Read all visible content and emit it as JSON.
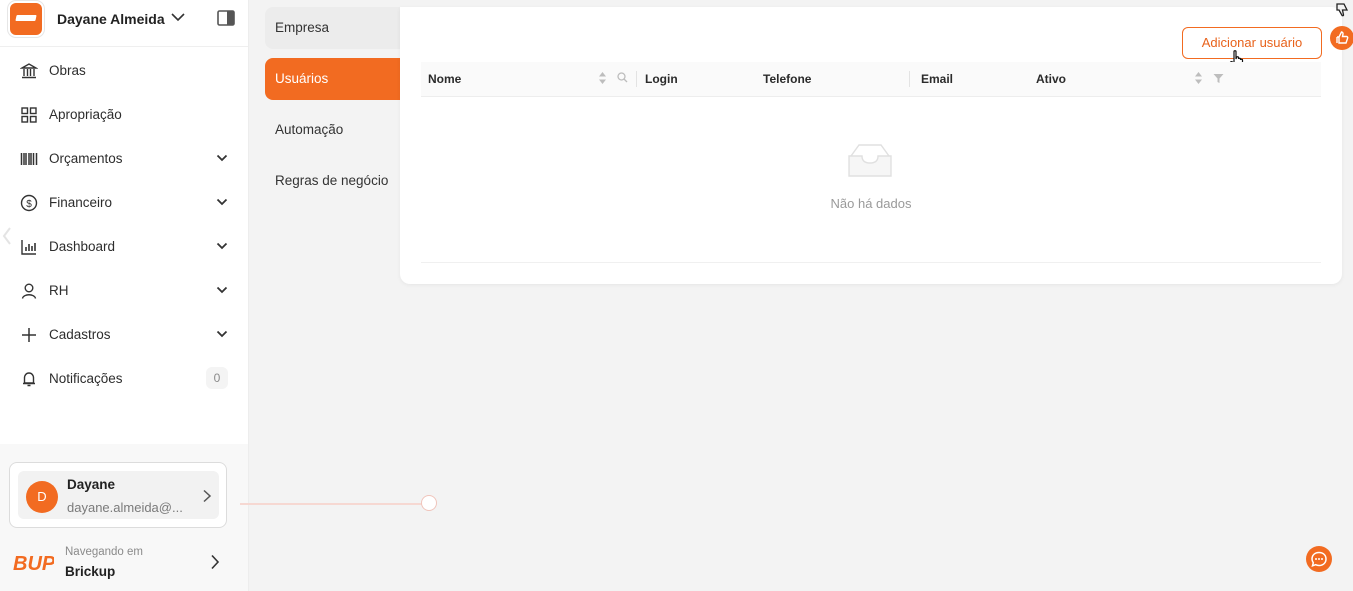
{
  "brand": {
    "name": "Dayane Almeida",
    "accent": "#f26b21"
  },
  "nav": [
    {
      "label": "Obras",
      "icon": "bank-icon",
      "has_children": false
    },
    {
      "label": "Apropriação",
      "icon": "grid-icon",
      "has_children": false
    },
    {
      "label": "Orçamentos",
      "icon": "barcode-icon",
      "has_children": true
    },
    {
      "label": "Financeiro",
      "icon": "dollar-circle-icon",
      "has_children": true
    },
    {
      "label": "Dashboard",
      "icon": "bar-chart-icon",
      "has_children": true
    },
    {
      "label": "RH",
      "icon": "user-icon",
      "has_children": true
    },
    {
      "label": "Cadastros",
      "icon": "plus-icon",
      "has_children": true
    },
    {
      "label": "Notificações",
      "icon": "bell-icon",
      "badge": "0"
    }
  ],
  "user": {
    "initial": "D",
    "name": "Dayane",
    "email": "dayane.almeida@..."
  },
  "company": {
    "subtitle": "Navegando em",
    "name": "Brickup",
    "logo_text": "BUP"
  },
  "submenu": [
    {
      "label": "Empresa",
      "active": false
    },
    {
      "label": "Usuários",
      "active": true
    },
    {
      "label": "Automação",
      "active": false
    },
    {
      "label": "Regras de negócio",
      "active": false
    }
  ],
  "table": {
    "add_button": "Adicionar usuário",
    "columns": [
      "Nome",
      "Login",
      "Telefone",
      "Email",
      "Ativo"
    ],
    "rows": [],
    "empty_text": "Não há dados"
  }
}
